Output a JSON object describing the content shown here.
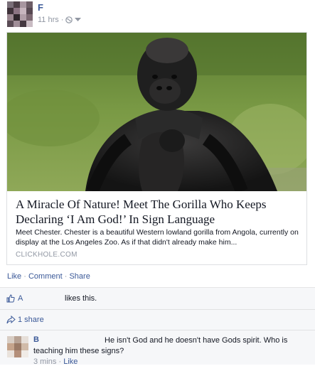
{
  "post": {
    "author": "F",
    "time": "11 hrs",
    "separator": "·"
  },
  "link": {
    "title": "A Miracle Of Nature! Meet The Gorilla Who Keeps Declaring ‘I Am God!’ In Sign Language",
    "description": "Meet Chester. Chester is a beautiful Western lowland gorilla from Angola, currently on display at the Los Angeles Zoo. As if that didn't already make him...",
    "source": "CLICKHOLE.COM"
  },
  "actions": {
    "like": "Like",
    "comment": "Comment",
    "share": "Share",
    "sep": "·"
  },
  "ufi": {
    "liker": "A",
    "likes_text": "likes this.",
    "share_count": "1 share"
  },
  "comment": {
    "author": "B",
    "text": "He isn't God and he doesn't have Gods spirit. Who is teaching him these signs?",
    "time": "3 mins",
    "sep": "·",
    "like": "Like"
  },
  "colors": {
    "link": "#3b5998",
    "muted": "#9197a3",
    "ufi_bg": "#f6f7f9"
  }
}
